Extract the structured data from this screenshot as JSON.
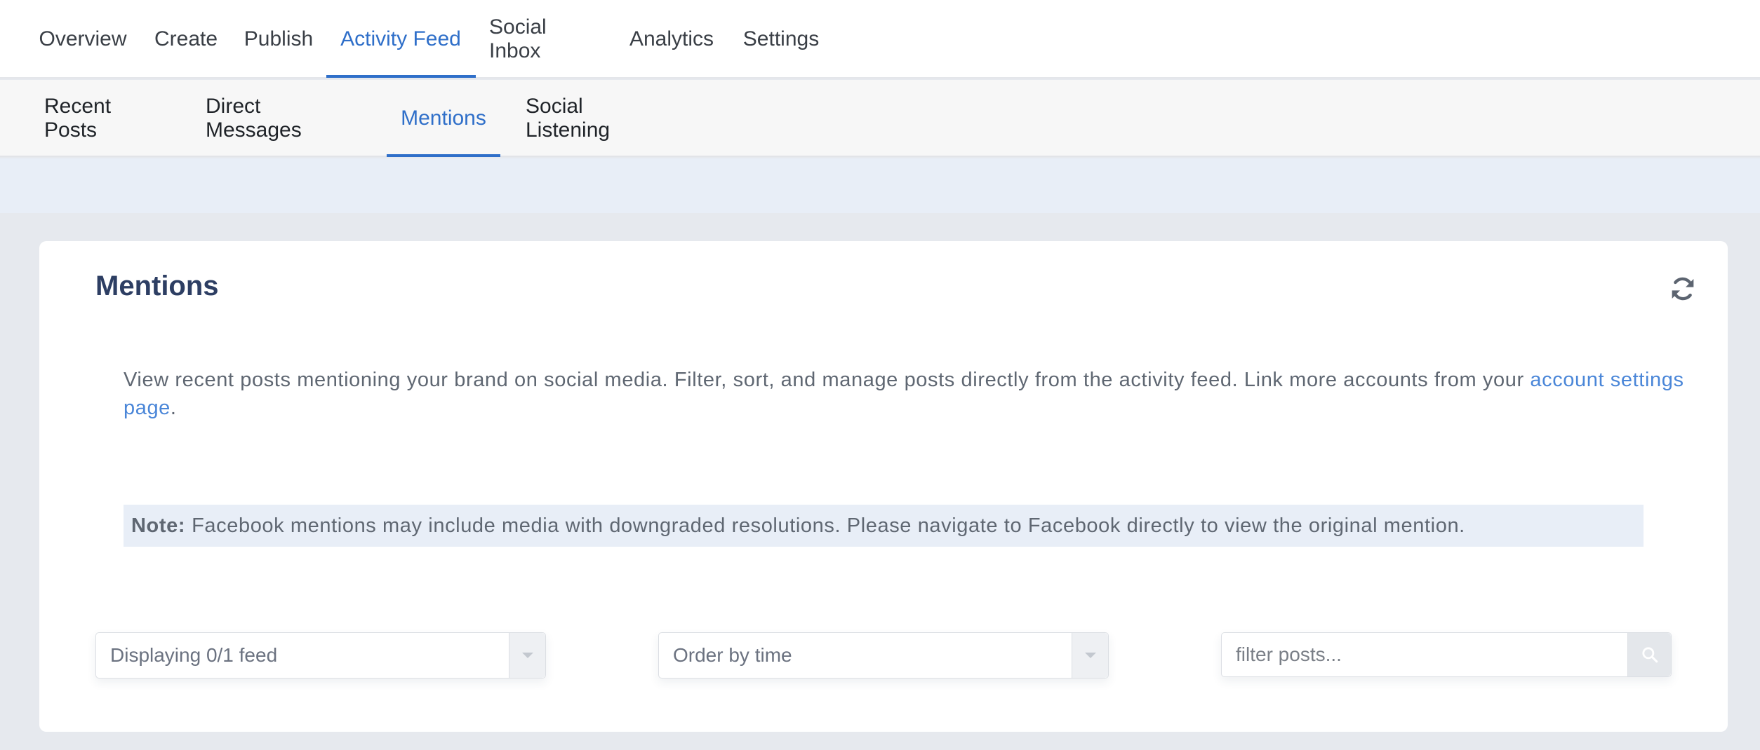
{
  "top_nav": {
    "tabs": [
      {
        "label": "Overview"
      },
      {
        "label": "Create"
      },
      {
        "label": "Publish"
      },
      {
        "label": "Activity Feed"
      },
      {
        "label": "Social Inbox"
      },
      {
        "label": "Analytics"
      },
      {
        "label": "Settings"
      }
    ],
    "active_index": 3
  },
  "sub_nav": {
    "tabs": [
      {
        "label": "Recent Posts"
      },
      {
        "label": "Direct Messages"
      },
      {
        "label": "Mentions"
      },
      {
        "label": "Social Listening"
      }
    ],
    "active_index": 2
  },
  "card": {
    "title": "Mentions",
    "description_text": "View recent posts mentioning your brand on social media. Filter, sort, and manage posts directly from the activity feed. Link more accounts from your ",
    "description_link": "account settings page",
    "description_end": ".",
    "note_label": "Note:",
    "note_text": "Facebook mentions may include media with downgraded resolutions. Please navigate to Facebook directly to view the original mention."
  },
  "filters": {
    "feed_select": "Displaying 0/1 feed",
    "order_select": "Order by time",
    "search_placeholder": "filter posts..."
  },
  "icons": {
    "refresh": "refresh-icon",
    "caret": "chevron-down-icon",
    "search": "search-icon"
  },
  "colors": {
    "accent": "#2f6fc9",
    "title": "#2d3e63",
    "link": "#4a86d8",
    "note_bg": "#e8eef7"
  }
}
